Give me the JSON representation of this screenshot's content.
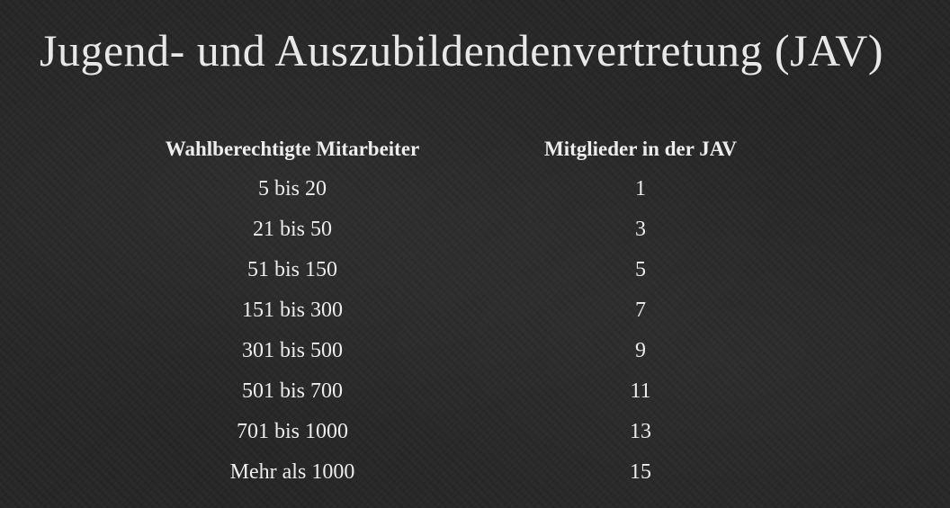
{
  "slide": {
    "title": "Jugend- und Auszubildendenvertretung (JAV)"
  },
  "table": {
    "headers": [
      "Wahlberechtigte Mitarbeiter",
      "Mitglieder in der JAV"
    ],
    "rows": [
      [
        "5 bis 20",
        "1"
      ],
      [
        "21 bis 50",
        "3"
      ],
      [
        "51 bis 150",
        "5"
      ],
      [
        "151 bis 300",
        "7"
      ],
      [
        "301 bis 500",
        "9"
      ],
      [
        "501 bis 700",
        "11"
      ],
      [
        "701 bis 1000",
        "13"
      ],
      [
        "Mehr als 1000",
        "15"
      ]
    ]
  },
  "colors": {
    "background": "#252525",
    "text": "#ececec"
  }
}
